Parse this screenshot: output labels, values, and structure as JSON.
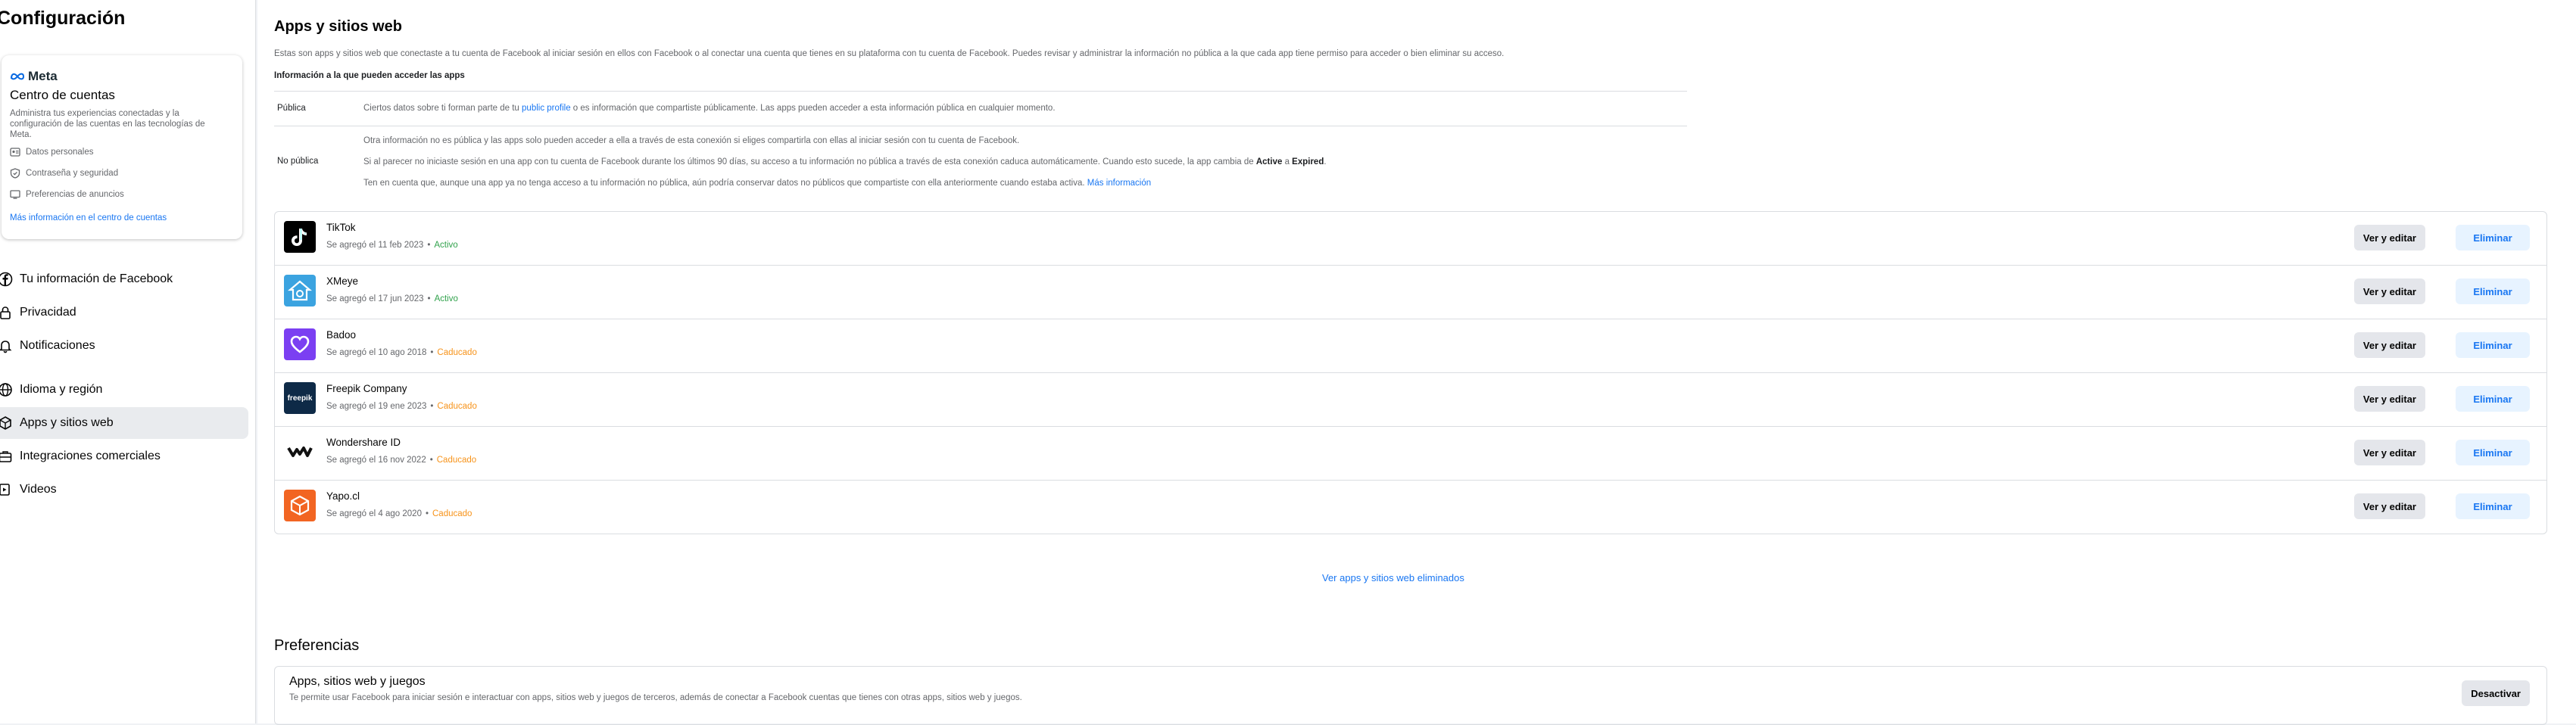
{
  "sidebar": {
    "title": "Configuración",
    "meta_card": {
      "brand": "Meta",
      "title": "Centro de cuentas",
      "description": "Administra tus experiencias conectadas y la configuración de las cuentas en las tecnologías de Meta.",
      "items": [
        {
          "label": "Datos personales",
          "icon": "id-card-icon"
        },
        {
          "label": "Contraseña y seguridad",
          "icon": "shield-icon"
        },
        {
          "label": "Preferencias de anuncios",
          "icon": "monitor-icon"
        }
      ],
      "link": "Más información en el centro de cuentas"
    },
    "nav": [
      {
        "label": "Tu información de Facebook",
        "icon": "facebook-icon"
      },
      {
        "label": "Privacidad",
        "icon": "lock-icon"
      },
      {
        "label": "Notificaciones",
        "icon": "bell-icon"
      },
      {
        "label": "Idioma y región",
        "icon": "globe-icon"
      },
      {
        "label": "Apps y sitios web",
        "icon": "cube-icon",
        "active": true
      },
      {
        "label": "Integraciones comerciales",
        "icon": "briefcase-icon"
      },
      {
        "label": "Videos",
        "icon": "video-icon"
      }
    ]
  },
  "main": {
    "title": "Apps y sitios web",
    "intro": "Estas son apps y sitios web que conectaste a tu cuenta de Facebook al iniciar sesión en ellos con Facebook o al conectar una cuenta que tienes en su plataforma con tu cuenta de Facebook. Puedes revisar y administrar la información no pública a la que cada app tiene permiso para acceder o bien eliminar su acceso.",
    "info_heading": "Información a la que pueden acceder las apps",
    "public": {
      "label": "Pública",
      "text_before": "Ciertos datos sobre ti forman parte de tu ",
      "link": "public profile",
      "text_after": " o es información que compartiste públicamente. Las apps pueden acceder a esta información pública en cualquier momento."
    },
    "nonpublic": {
      "label": "No pública",
      "p1": "Otra información no es pública y las apps solo pueden acceder a ella a través de esta conexión si eliges compartirla con ellas al iniciar sesión con tu cuenta de Facebook.",
      "p2_before": "Si al parecer no iniciaste sesión en una app con tu cuenta de Facebook durante los últimos 90 días, su acceso a tu información no pública a través de esta conexión caduca automáticamente. Cuando esto sucede, la app cambia de ",
      "p2_b1": "Active",
      "p2_mid": " a ",
      "p2_b2": "Expired",
      "p2_end": ".",
      "p3_before": "Ten en cuenta que, aunque una app ya no tenga acceso a tu información no pública, aún podría conservar datos no públicos que compartiste con ella anteriormente cuando estaba activa. ",
      "p3_link": "Más información"
    },
    "apps": [
      {
        "name": "TikTok",
        "added": "Se agregó el 11 feb 2023",
        "status": "Activo",
        "state": "active",
        "icon": "tiktok-icon",
        "color": "#000000"
      },
      {
        "name": "XMeye",
        "added": "Se agregó el 17 jun 2023",
        "status": "Activo",
        "state": "active",
        "icon": "xmeye-icon",
        "color": "#3ba3e0"
      },
      {
        "name": "Badoo",
        "added": "Se agregó el 10 ago 2018",
        "status": "Caducado",
        "state": "expired",
        "icon": "badoo-icon",
        "color": "#7b3ff2"
      },
      {
        "name": "Freepik Company",
        "added": "Se agregó el 19 ene 2023",
        "status": "Caducado",
        "state": "expired",
        "icon": "freepik-icon",
        "color": "#0e2a47",
        "logo_text": "freepik"
      },
      {
        "name": "Wondershare ID",
        "added": "Se agregó el 16 nov 2022",
        "status": "Caducado",
        "state": "expired",
        "icon": "wondershare-icon",
        "color": "#ffffff"
      },
      {
        "name": "Yapo.cl",
        "added": "Se agregó el 4 ago 2020",
        "status": "Caducado",
        "state": "expired",
        "icon": "yapo-icon",
        "color": "#f26522"
      }
    ],
    "edit_label": "Ver y editar",
    "remove_label": "Eliminar",
    "removed_link": "Ver apps y sitios web eliminados",
    "preferences": {
      "title": "Preferencias",
      "name": "Apps, sitios web y juegos",
      "description": "Te permite usar Facebook para iniciar sesión e interactuar con apps, sitios web y juegos de terceros, además de conectar a Facebook cuentas que tienes con otras apps, sitios web y juegos.",
      "button": "Desactivar"
    }
  },
  "colors": {
    "accent": "#1876f2",
    "active": "#31a24c",
    "expired": "#f7931a"
  }
}
